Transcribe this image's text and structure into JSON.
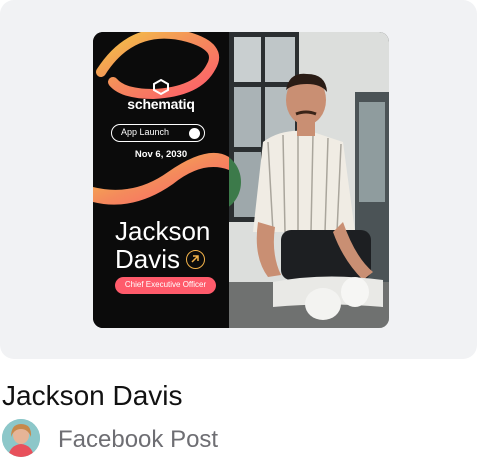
{
  "design": {
    "brand": "schematiq",
    "event_pill": "App Launch",
    "event_date": "Nov 6, 2030",
    "person_first": "Jackson",
    "person_last": "Davis",
    "role": "Chief Executive Officer"
  },
  "card": {
    "title": "Jackson Davis",
    "type": "Facebook Post"
  },
  "colors": {
    "card_bg": "#f1f2f4",
    "accent_pink": "#ff5b6b",
    "accent_orange": "#f2a84a"
  }
}
